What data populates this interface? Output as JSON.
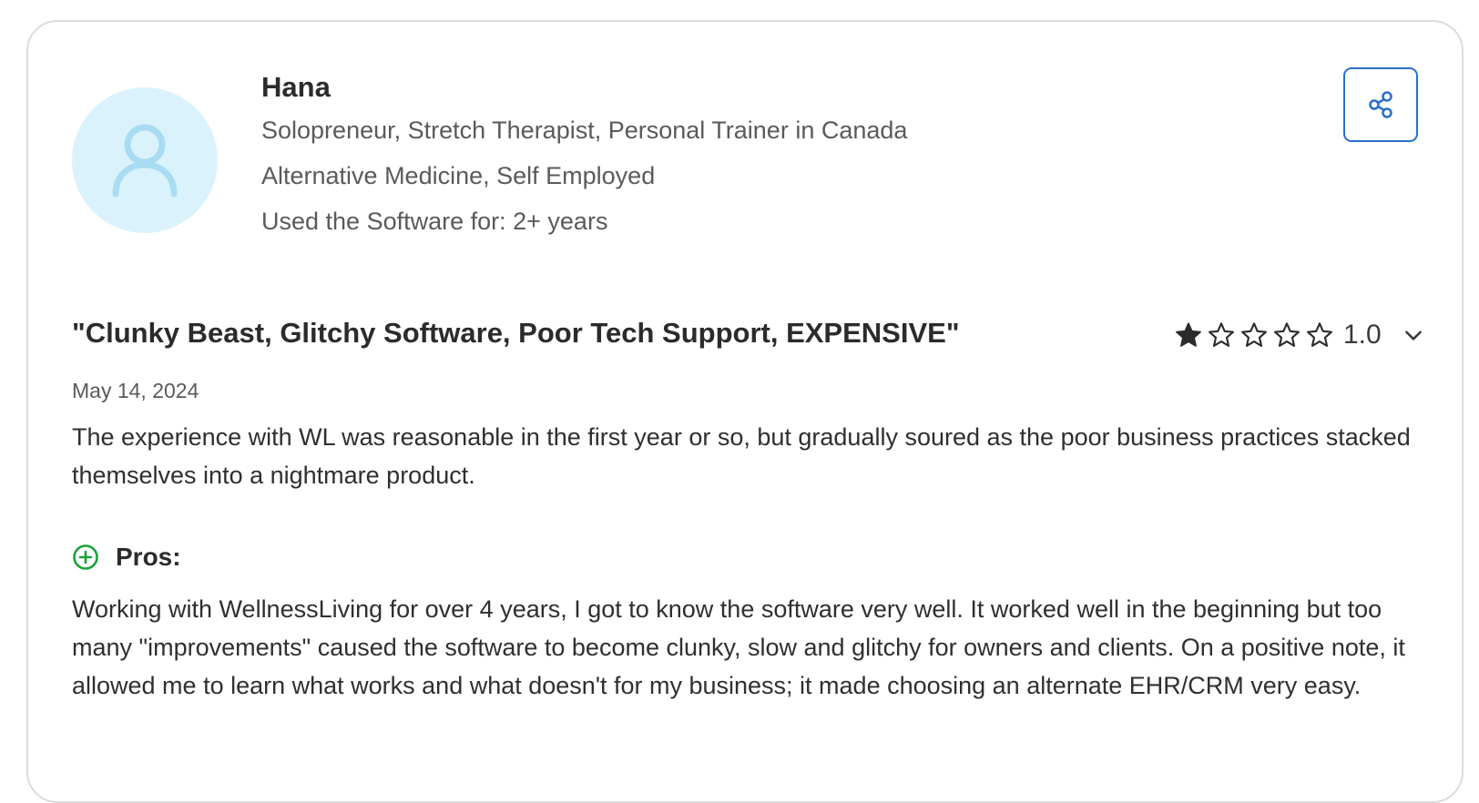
{
  "reviewer": {
    "name": "Hana",
    "role": "Solopreneur, Stretch Therapist, Personal Trainer in Canada",
    "industry": "Alternative Medicine, Self Employed",
    "usage": "Used the Software for: 2+ years",
    "avatar_icon": "user-placeholder-icon"
  },
  "share": {
    "icon": "share-icon",
    "color": "#2a6fc9"
  },
  "review": {
    "title": "\"Clunky Beast, Glitchy Software, Poor Tech Support, EXPENSIVE\"",
    "rating": {
      "value": 1.0,
      "max": 5,
      "display": "1.0"
    },
    "date": "May 14, 2024",
    "summary": "The experience with WL was reasonable in the first year or so, but gradually soured as the poor business practices stacked themselves into a nightmare product.",
    "pros": {
      "label": "Pros:",
      "icon": "plus-circle-icon",
      "icon_color": "#1aa33a",
      "text": "Working with WellnessLiving for over 4 years, I got to know the software very well. It worked well in the beginning but too many \"improvements\" caused the software to become clunky, slow and glitchy for owners and clients. On a positive note, it allowed me to learn what works and what doesn't for my business; it made choosing an alternate EHR/CRM very easy."
    }
  },
  "colors": {
    "avatar_bg": "#daf2fb",
    "avatar_icon": "#a9dcf3",
    "card_border": "#dcdcdc"
  }
}
